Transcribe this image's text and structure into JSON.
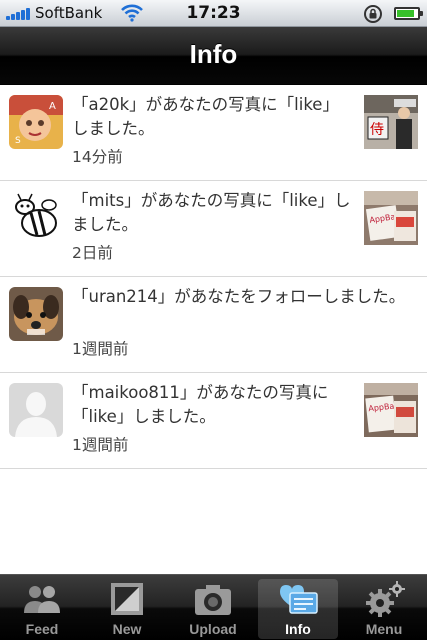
{
  "status_bar": {
    "carrier": "SoftBank",
    "time": "17:23",
    "battery_level": 0.85,
    "signal_bars": 5,
    "accent_color": "#1f6fd6"
  },
  "nav": {
    "title": "Info"
  },
  "notifications": [
    {
      "message": "「a20k」があなたの写真に「like」しました。",
      "time": "14分前",
      "avatar_icon": "user-photo-avatar",
      "has_thumbnail": true
    },
    {
      "message": "「mits」があなたの写真に「like」しました。",
      "time": "2日前",
      "avatar_icon": "bee-drawing-avatar",
      "has_thumbnail": true
    },
    {
      "message": "「uran214」があなたをフォローしました。",
      "time": "1週間前",
      "avatar_icon": "dog-photo-avatar",
      "has_thumbnail": false
    },
    {
      "message": "「maikoo811」があなたの写真に「like」しました。",
      "time": "1週間前",
      "avatar_icon": "default-user-avatar",
      "has_thumbnail": true
    }
  ],
  "tabs": [
    {
      "label": "Feed",
      "icon": "people-icon",
      "selected": false
    },
    {
      "label": "New",
      "icon": "picture-frame-icon",
      "selected": false
    },
    {
      "label": "Upload",
      "icon": "camera-icon",
      "selected": false
    },
    {
      "label": "Info",
      "icon": "heart-message-icon",
      "selected": true
    },
    {
      "label": "Menu",
      "icon": "gear-icon",
      "selected": false
    }
  ]
}
